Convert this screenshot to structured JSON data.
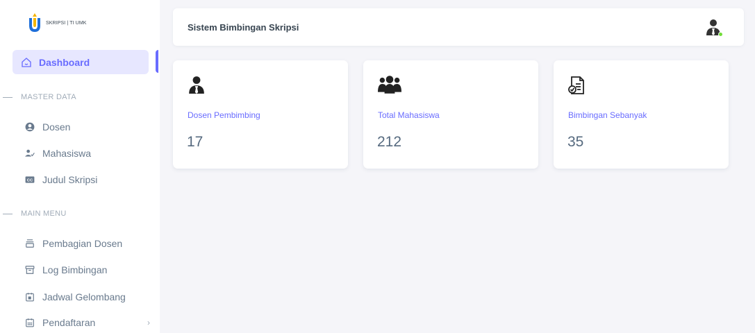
{
  "brand": {
    "text": "SKRIPSI | TI UMK"
  },
  "sidebar": {
    "active": {
      "label": "Dashboard"
    },
    "sections": [
      {
        "title": "MASTER DATA",
        "items": [
          {
            "label": "Dosen",
            "icon": "user-circle-icon"
          },
          {
            "label": "Mahasiswa",
            "icon": "user-check-icon"
          },
          {
            "label": "Judul Skripsi",
            "icon": "closed-caption-icon"
          }
        ]
      },
      {
        "title": "MAIN MENU",
        "items": [
          {
            "label": "Pembagian Dosen",
            "icon": "stack-icon"
          },
          {
            "label": "Log Bimbingan",
            "icon": "archive-icon"
          },
          {
            "label": "Jadwal Gelombang",
            "icon": "calendar-event-icon"
          },
          {
            "label": "Pendaftaran",
            "icon": "calendar-grid-icon",
            "chevron": "›"
          }
        ]
      }
    ]
  },
  "navbar": {
    "title": "Sistem Bimbingan Skripsi"
  },
  "cards": [
    {
      "label": "Dosen Pembimbing",
      "value": "17",
      "icon": "user-tie-icon"
    },
    {
      "label": "Total Mahasiswa",
      "value": "212",
      "icon": "users-group-icon"
    },
    {
      "label": "Bimbingan Sebanyak",
      "value": "35",
      "icon": "file-check-icon"
    }
  ],
  "colors": {
    "accent": "#696cff",
    "online": "#71dd37",
    "text": "#566a7f"
  }
}
